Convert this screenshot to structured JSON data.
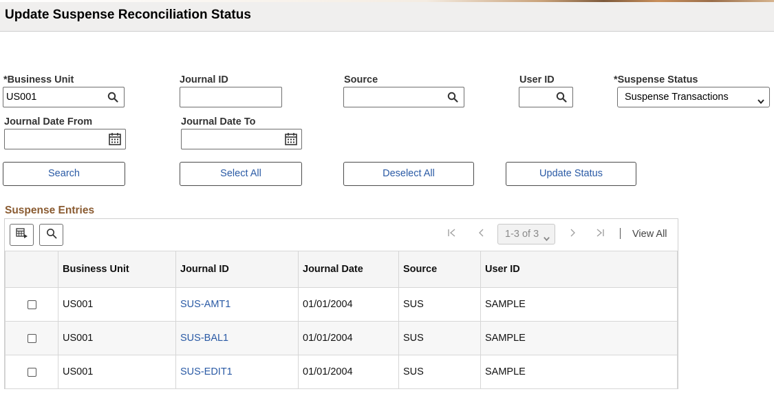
{
  "page_title": "Update Suspense Reconciliation Status",
  "filters": {
    "business_unit_label": "*Business Unit",
    "business_unit_value": "US001",
    "journal_id_label": "Journal ID",
    "journal_id_value": "",
    "source_label": "Source",
    "source_value": "",
    "user_id_label": "User ID",
    "user_id_value": "",
    "suspense_status_label": "*Suspense Status",
    "suspense_status_value": "Suspense Transactions",
    "journal_date_from_label": "Journal Date From",
    "journal_date_from_value": "",
    "journal_date_to_label": "Journal Date To",
    "journal_date_to_value": ""
  },
  "buttons": {
    "search": "Search",
    "select_all": "Select All",
    "deselect_all": "Deselect All",
    "update_status": "Update Status"
  },
  "grid": {
    "title": "Suspense Entries",
    "pager": {
      "range": "1-3 of 3",
      "view_all": "View All"
    },
    "columns": [
      "",
      "Business Unit",
      "Journal ID",
      "Journal Date",
      "Source",
      "User ID"
    ],
    "rows": [
      {
        "business_unit": "US001",
        "journal_id": "SUS-AMT1",
        "journal_date": "01/01/2004",
        "source": "SUS",
        "user_id": "SAMPLE",
        "checked": false
      },
      {
        "business_unit": "US001",
        "journal_id": "SUS-BAL1",
        "journal_date": "01/01/2004",
        "source": "SUS",
        "user_id": "SAMPLE",
        "checked": false
      },
      {
        "business_unit": "US001",
        "journal_id": "SUS-EDIT1",
        "journal_date": "01/01/2004",
        "source": "SUS",
        "user_id": "SAMPLE",
        "checked": false
      }
    ]
  },
  "colors": {
    "link": "#2a5aa5",
    "section_title": "#8a5b31",
    "header_bg": "#f0efee"
  },
  "icons": {
    "lookup": "search-icon",
    "calendar": "calendar-icon",
    "personalize": "grid-personalize-icon",
    "find": "search-icon"
  }
}
